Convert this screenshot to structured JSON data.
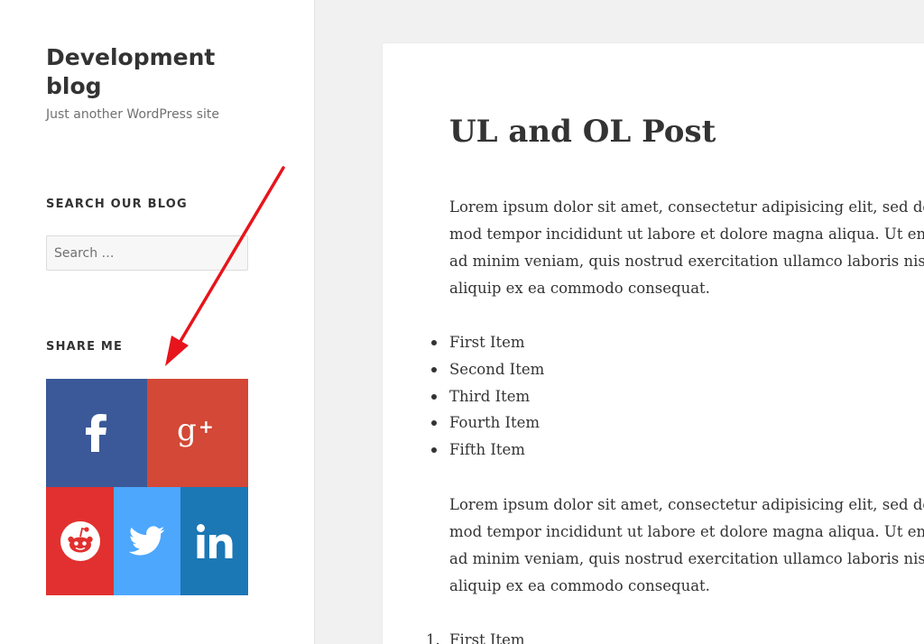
{
  "site": {
    "title": "Development blog",
    "tagline": "Just another WordPress site"
  },
  "widgets": {
    "search": {
      "heading": "SEARCH OUR BLOG",
      "placeholder": "Search …"
    },
    "share": {
      "heading": "SHARE ME",
      "buttons": [
        {
          "network": "Facebook",
          "icon": "facebook-icon",
          "color": "#3b5998"
        },
        {
          "network": "Google+",
          "icon": "google-plus-icon",
          "color": "#d34836"
        },
        {
          "network": "Reddit",
          "icon": "reddit-icon",
          "color": "#e1302f"
        },
        {
          "network": "Twitter",
          "icon": "twitter-icon",
          "color": "#4da7fd"
        },
        {
          "network": "LinkedIn",
          "icon": "linkedin-icon",
          "color": "#1c77b5"
        }
      ]
    }
  },
  "annotation": {
    "color": "#e8141c"
  },
  "post": {
    "title": "UL and OL Post",
    "paragraph1": [
      "Lorem ipsum dolor sit amet, consectetur adipisicing elit, sed do eius",
      "mod tempor incididunt ut labore et dolore magna aliqua. Ut enim",
      "ad minim veniam, quis nostrud exercitation ullamco laboris nisi ut",
      "aliquip ex ea commodo consequat."
    ],
    "unordered_list": [
      "First Item",
      "Second Item",
      "Third Item",
      "Fourth Item",
      "Fifth Item"
    ],
    "paragraph2": [
      "Lorem ipsum dolor sit amet, consectetur adipisicing elit, sed do eius",
      "mod tempor incididunt ut labore et dolore magna aliqua. Ut enim",
      "ad minim veniam, quis nostrud exercitation ullamco laboris nisi ut",
      "aliquip ex ea commodo consequat."
    ],
    "ordered_list": [
      {
        "number": "1.",
        "label": "First Item"
      }
    ]
  }
}
